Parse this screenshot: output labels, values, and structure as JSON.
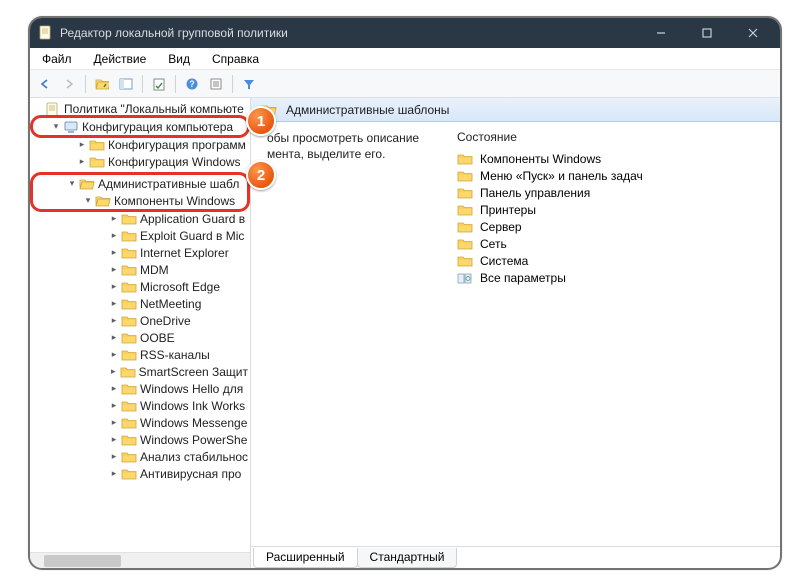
{
  "window": {
    "title": "Редактор локальной групповой политики"
  },
  "menu": {
    "file": "Файл",
    "action": "Действие",
    "view": "Вид",
    "help": "Справка"
  },
  "tree": {
    "root": "Политика \"Локальный компьюте",
    "computer_config": "Конфигурация компьютера",
    "software_settings": "Конфигурация программ",
    "windows_settings": "Конфигурация Windows",
    "admin_templates": "Административные шабл",
    "windows_components": "Компоненты Windows",
    "items": [
      "Application Guard в",
      "Exploit Guard в Mic",
      "Internet Explorer",
      "MDM",
      "Microsoft Edge",
      "NetMeeting",
      "OneDrive",
      "OOBE",
      "RSS-каналы",
      "SmartScreen Защит",
      "Windows Hello для",
      "Windows Ink Works",
      "Windows Messenge",
      "Windows PowerShe",
      "Анализ стабильнос",
      "Антивирусная про"
    ]
  },
  "content": {
    "header": "Административные шаблоны",
    "hint_line1": "обы просмотреть описание",
    "hint_line2": "мента, выделите его.",
    "state_header": "Состояние",
    "items": [
      {
        "type": "folder",
        "label": "Компоненты Windows"
      },
      {
        "type": "folder",
        "label": "Меню «Пуск» и панель задач"
      },
      {
        "type": "folder",
        "label": "Панель управления"
      },
      {
        "type": "folder",
        "label": "Принтеры"
      },
      {
        "type": "folder",
        "label": "Сервер"
      },
      {
        "type": "folder",
        "label": "Сеть"
      },
      {
        "type": "folder",
        "label": "Система"
      },
      {
        "type": "settings",
        "label": "Все параметры"
      }
    ]
  },
  "tabs": {
    "extended": "Расширенный",
    "standard": "Стандартный"
  },
  "callouts": {
    "one": "1",
    "two": "2"
  }
}
